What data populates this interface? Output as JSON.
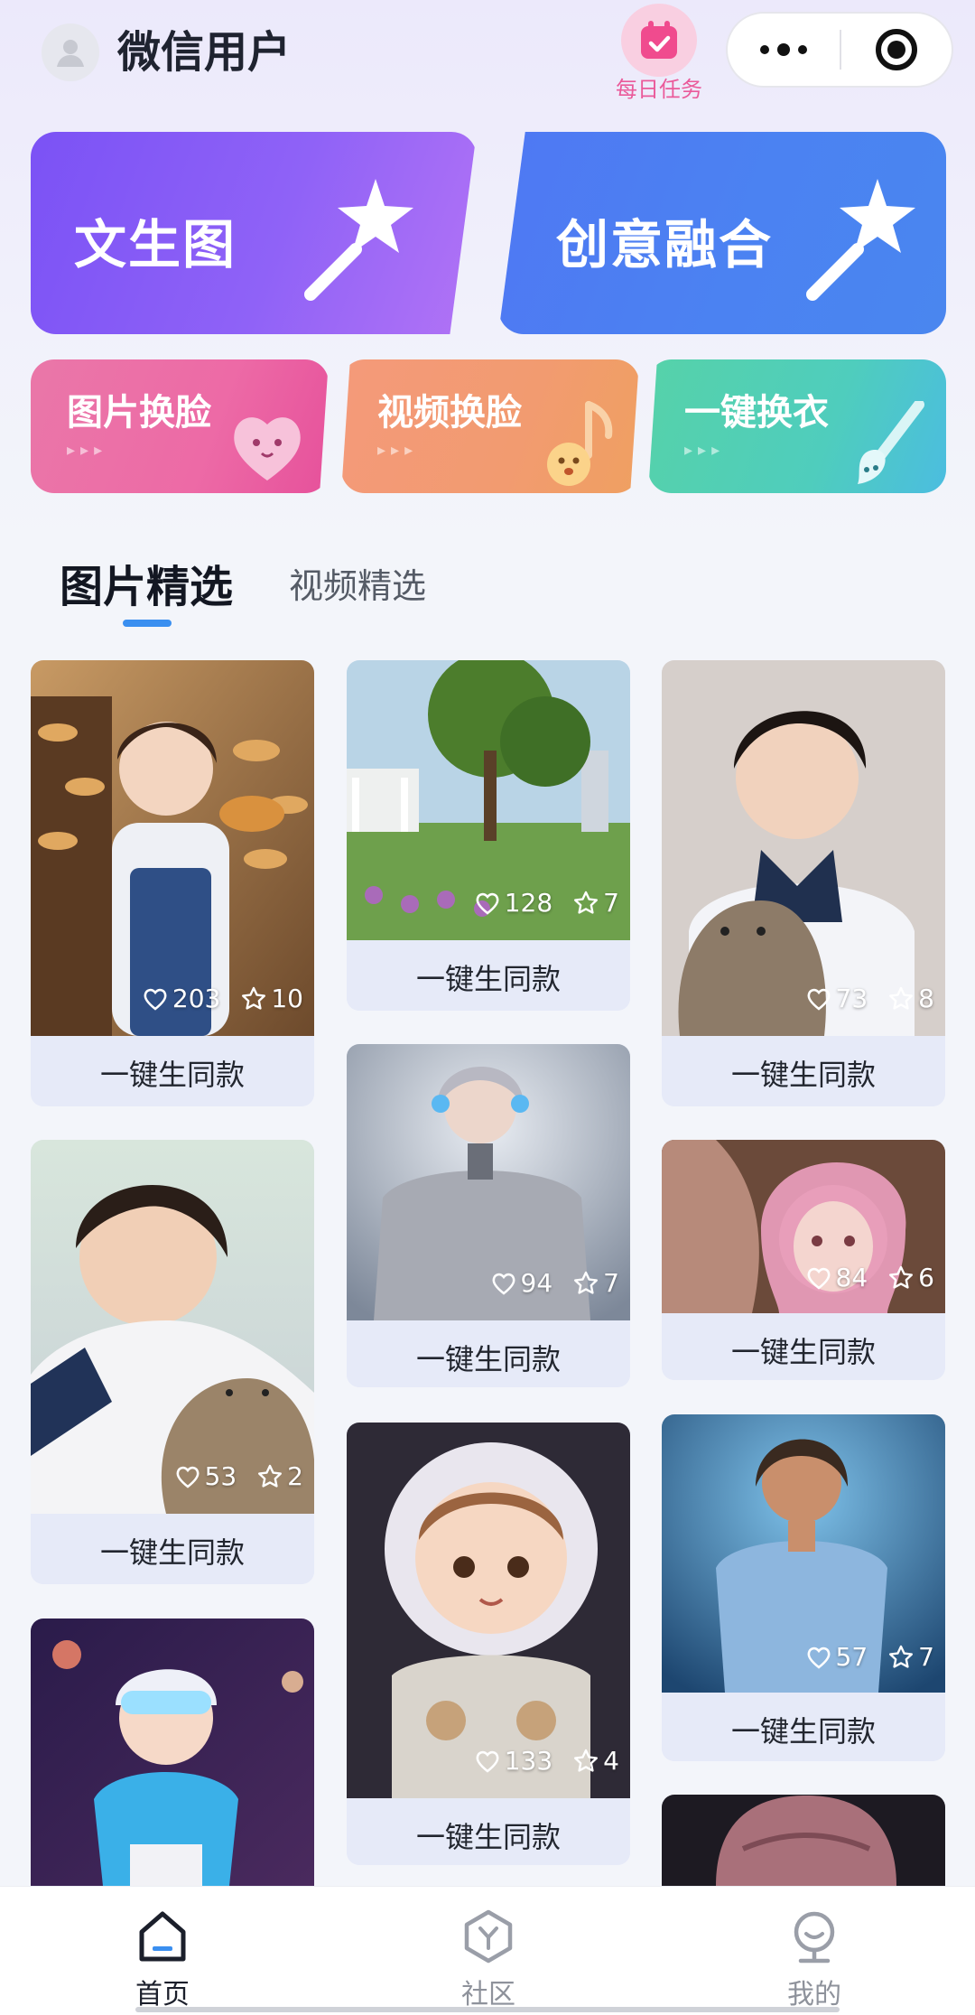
{
  "header": {
    "username": "微信用户",
    "avatar_icon": "user-avatar-icon",
    "daily_task": {
      "label": "每日任务",
      "icon": "calendar-check-icon"
    },
    "capsule": {
      "more_icon": "more-dots-icon",
      "close_icon": "target-close-icon"
    }
  },
  "features": {
    "primary": [
      {
        "label": "文生图",
        "icon": "magic-wand-icon"
      },
      {
        "label": "创意融合",
        "icon": "magic-wand-icon"
      }
    ],
    "secondary": [
      {
        "label": "图片换脸",
        "arrows": "▸▸▸",
        "icon": "heart-face-icon"
      },
      {
        "label": "视频换脸",
        "arrows": "▸▸▸",
        "icon": "music-note-face-icon"
      },
      {
        "label": "一键换衣",
        "arrows": "▸▸▸",
        "icon": "brush-icon"
      }
    ]
  },
  "tabs": [
    {
      "label": "图片精选",
      "active": true
    },
    {
      "label": "视频精选",
      "active": false
    }
  ],
  "gallery": {
    "button_label": "一键生同款",
    "items": [
      {
        "likes": "203",
        "stars": "10"
      },
      {
        "likes": "128",
        "stars": "7"
      },
      {
        "likes": "73",
        "stars": "8"
      },
      {
        "likes": "53",
        "stars": "2"
      },
      {
        "likes": "94",
        "stars": "7"
      },
      {
        "likes": "84",
        "stars": "6"
      },
      {
        "likes": "133",
        "stars": "4"
      },
      {
        "likes": "57",
        "stars": "7"
      }
    ]
  },
  "tabbar": [
    {
      "label": "首页",
      "icon": "home-icon",
      "active": true
    },
    {
      "label": "社区",
      "icon": "community-hex-icon",
      "active": false
    },
    {
      "label": "我的",
      "icon": "profile-icon",
      "active": false
    }
  ]
}
